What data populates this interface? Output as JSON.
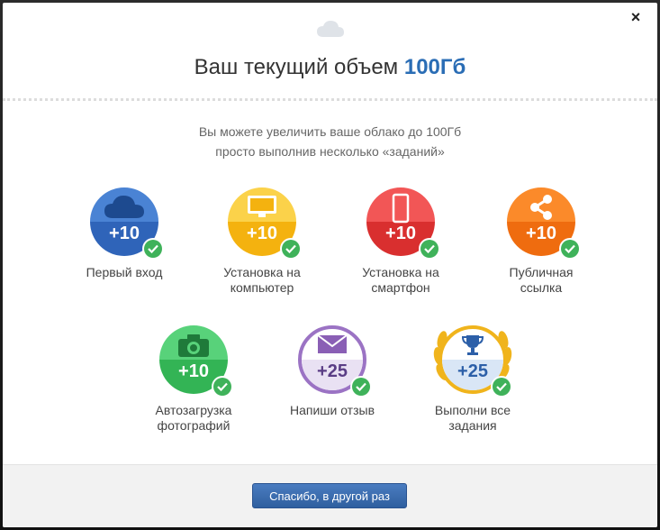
{
  "dialog": {
    "close_label": "×",
    "title_prefix": "Ваш текущий объем",
    "title_value": "100Гб",
    "subtitle_line1": "Вы можете увеличить ваше облако до 100Гб",
    "subtitle_line2": "просто выполнив несколько «заданий»"
  },
  "tasks": [
    {
      "label_line1": "Первый вход",
      "label_line2": "",
      "points": "+10",
      "icon": "cloud-icon",
      "color_top": "#4a83d4",
      "color_bottom": "#2f64b9"
    },
    {
      "label_line1": "Установка на",
      "label_line2": "компьютер",
      "points": "+10",
      "icon": "monitor-icon",
      "color_top": "#fbd24a",
      "color_bottom": "#f4b20f"
    },
    {
      "label_line1": "Установка на",
      "label_line2": "смартфон",
      "points": "+10",
      "icon": "smartphone-icon",
      "color_top": "#f25656",
      "color_bottom": "#d92f2f"
    },
    {
      "label_line1": "Публичная",
      "label_line2": "ссылка",
      "points": "+10",
      "icon": "share-icon",
      "color_top": "#fb8a2a",
      "color_bottom": "#ef6c0f"
    },
    {
      "label_line1": "Автозагрузка",
      "label_line2": "фотографий",
      "points": "+10",
      "icon": "camera-icon",
      "color_top": "#58d27a",
      "color_bottom": "#33b455"
    },
    {
      "label_line1": "Напиши отзыв",
      "label_line2": "",
      "points": "+25",
      "icon": "envelope-icon",
      "color_top": "#ffffff",
      "color_bottom": "#8a5fb5"
    },
    {
      "label_line1": "Выполни все",
      "label_line2": "задания",
      "points": "+25",
      "icon": "trophy-icon",
      "color_top": "#ffffff",
      "color_bottom": "#3a74c6"
    }
  ],
  "footer": {
    "button_label": "Спасибо, в другой раз"
  }
}
